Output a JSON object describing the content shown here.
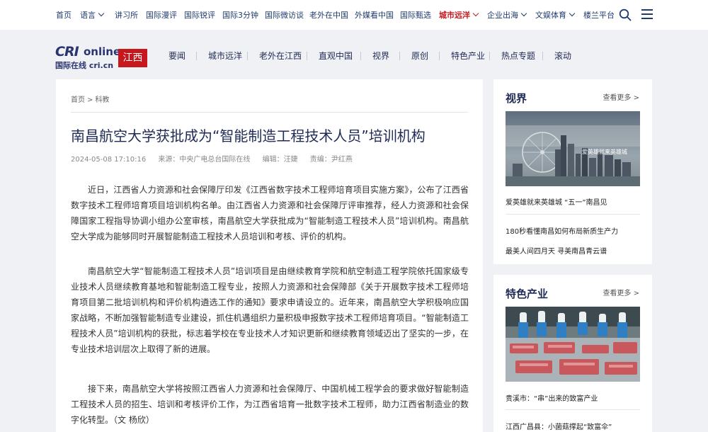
{
  "topnav": {
    "items": [
      "首页",
      "语言",
      "讲习所",
      "国际漫评",
      "国际锐评",
      "国际3分钟",
      "国际微访谈",
      "老外在中国",
      "外媒看中国",
      "国际甄选",
      "城市远洋",
      "企业出海",
      "文娱体育",
      "楼兰平台"
    ],
    "active_color": "#c8161d"
  },
  "channel": {
    "logo_cri": "CRI",
    "logo_online": "online",
    "logo_sub": "国际在线 cri.cn",
    "region": "江西",
    "nav": [
      "要闻",
      "城市远洋",
      "老外在江西",
      "直观中国",
      "视界",
      "原创",
      "特色产业",
      "热点专题",
      "滚动"
    ]
  },
  "article": {
    "breadcrumb": [
      "首页",
      "科教"
    ],
    "title": "南昌航空大学获批成为“智能制造工程技术人员”培训机构",
    "date": "2024-05-08 17:10:16",
    "source": "来源：中央广电总台国际在线",
    "editor": "编辑：汪婕",
    "responsible": "责编：尹红燕",
    "paragraphs": [
      "近日，江西省人力资源和社会保障厅印发《江西省数字技术工程师培育项目实施方案》，公布了江西省数字技术工程师培育项目培训机构名单。由江西省人力资源和社会保障厅评审推荐，经人力资源和社会保障国家工程指导协调小组办公室审核，南昌航空大学获批成为“智能制造工程技术人员”培训机构。南昌航空大学成为能够同时开展智能制造工程技术人员培训和考核、评价的机构。",
      "南昌航空大学“智能制造工程技术人员”培训项目是由继续教育学院和航空制造工程学院依托国家级专业技术人员继续教育基地和智能制造工程专业，按照人力资源和社会保障部《关于开展数字技术工程师培育项目第二批培训机构和评价机构遴选工作的通知》要求申请设立的。近年来，南昌航空大学积极响应国家战略，不断加强智能制造专业建设，抓住机遇组织力量积极申报数字技术工程师培育项目。“智能制造工程技术人员”培训机构的获批，标志着学校在专业技术人才知识更新和继续教育领域迈出了坚实的一步，在专业技术培训层次上取得了新的进展。",
      "接下来，南昌航空大学将按照江西省人力资源和社会保障厅、中国机械工程学会的要求做好智能制造工程技术人员的招生、培训和考核评价工作，为江西省培育一批数字技术工程师，助力江西省制造业的数字化转型。（文 杨欣）"
    ]
  },
  "sidebar": {
    "vision": {
      "title": "视界",
      "more": "查看更多 >",
      "image_caption_overlay": "爱英雄就来英雄城",
      "items": [
        "爱英雄就来英雄城 “五一”南昌见",
        "180秒看懂南昌如何布局新质生产力",
        "最美人间四月天 寻美南昌青云谱"
      ]
    },
    "industry": {
      "title": "特色产业",
      "more": "查看更多 >",
      "items": [
        "贵溪市：“串”出来的致富产业",
        "江西广昌县：小菌菇撑起“致富伞”"
      ]
    }
  }
}
